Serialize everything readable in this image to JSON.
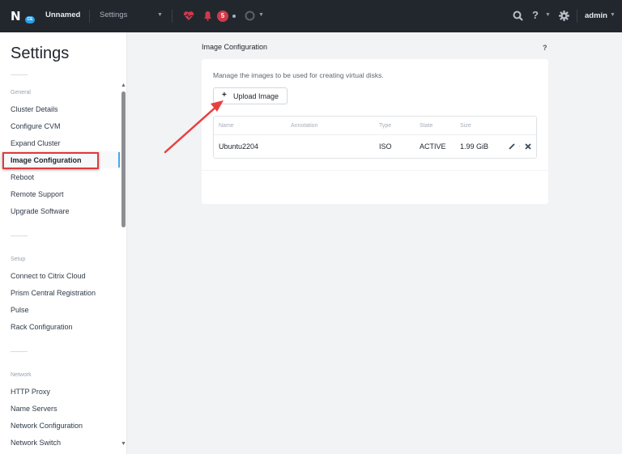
{
  "topbar": {
    "logo_badge": "CE",
    "cluster_name": "Unnamed",
    "page_menu": "Settings",
    "alert_count": "5",
    "user": "admin",
    "icons": [
      "health-heart-icon",
      "bell-icon",
      "tasks-circle-icon",
      "search-icon",
      "help-icon",
      "gear-icon"
    ]
  },
  "sidebar": {
    "title": "Settings",
    "groups": [
      {
        "label": "General",
        "items": [
          "Cluster Details",
          "Configure CVM",
          "Expand Cluster",
          "Image Configuration",
          "Reboot",
          "Remote Support",
          "Upgrade Software"
        ]
      },
      {
        "label": "Setup",
        "items": [
          "Connect to Citrix Cloud",
          "Prism Central Registration",
          "Pulse",
          "Rack Configuration"
        ]
      },
      {
        "label": "Network",
        "items": [
          "HTTP Proxy",
          "Name Servers",
          "Network Configuration",
          "Network Switch"
        ]
      }
    ],
    "active_item": "Image Configuration"
  },
  "main": {
    "title": "Image Configuration",
    "help": "?",
    "description": "Manage the images to be used for creating virtual disks.",
    "upload_button": "Upload Image",
    "upload_icon": "+",
    "table": {
      "columns": [
        "Name",
        "Annotation",
        "Type",
        "State",
        "Size"
      ],
      "rows": [
        {
          "name": "Ubuntu2204",
          "annotation": "",
          "type": "ISO",
          "state": "ACTIVE",
          "size": "1.99 GiB"
        }
      ]
    }
  },
  "annotation_colors": {
    "highlight": "#e03a3a",
    "accent": "#4ba6e8",
    "alert": "#cf3a4b"
  }
}
